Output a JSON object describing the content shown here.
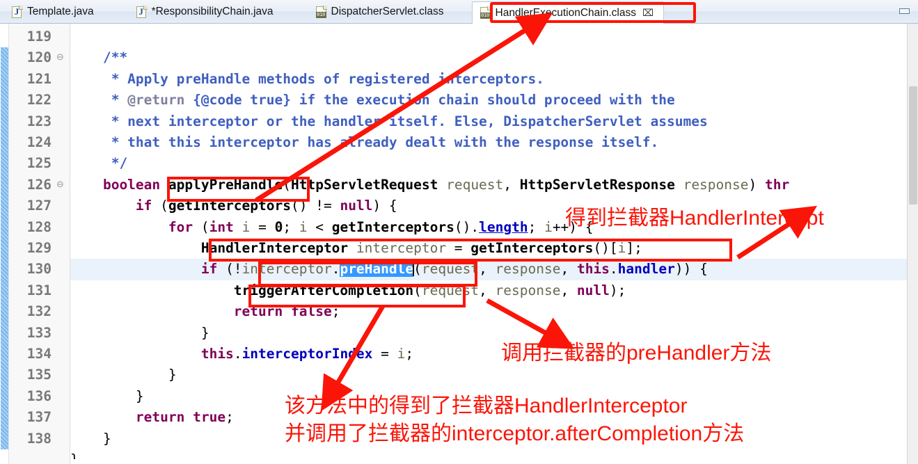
{
  "window": {
    "minimize_label": "Minimize",
    "accent_red": "#fb1508",
    "selection_blue": "#3399ff",
    "current_line_blue": "#eaf2fb"
  },
  "tabs": [
    {
      "label": "Template.java",
      "icon": "java-file-icon",
      "active": false,
      "dirty": false
    },
    {
      "label": "*ResponsibilityChain.java",
      "icon": "java-file-icon",
      "active": false,
      "dirty": true
    },
    {
      "label": "DispatcherServlet.class",
      "icon": "class-file-icon",
      "active": false,
      "dirty": false
    },
    {
      "label": "HandlerExecutionChain.class",
      "icon": "class-file-icon",
      "active": true,
      "dirty": false,
      "close_glyph": "⌧"
    }
  ],
  "editor": {
    "first_line": 119,
    "line_numbers": [
      "119",
      "120",
      "121",
      "122",
      "123",
      "124",
      "125",
      "126",
      "127",
      "128",
      "129",
      "130",
      "131",
      "132",
      "133",
      "134",
      "135",
      "136",
      "137",
      "138"
    ],
    "fold_lines": [
      "120",
      "126"
    ],
    "fold_glyph": "⊖",
    "current_line": 130,
    "selected_token": "preHandle",
    "code_lines": [
      "",
      "    /**",
      "     * Apply preHandle methods of registered interceptors.",
      "     * @return {@code true} if the execution chain should proceed with the",
      "     * next interceptor or the handler itself. Else, DispatcherServlet assumes",
      "     * that this interceptor has already dealt with the response itself.",
      "     */",
      "    boolean applyPreHandle(HttpServletRequest request, HttpServletResponse response) thr",
      "        if (getInterceptors() != null) {",
      "            for (int i = 0; i < getInterceptors().length; i++) {",
      "                HandlerInterceptor interceptor = getInterceptors()[i];",
      "                if (!interceptor.preHandle(request, response, this.handler)) {",
      "                    triggerAfterCompletion(request, response, null);",
      "                    return false;",
      "                }",
      "                this.interceptorIndex = i;",
      "            }",
      "        }",
      "        return true;",
      "    }"
    ]
  },
  "annotations": {
    "boxes": [
      {
        "name": "active-tab-highlight-box"
      },
      {
        "name": "apply-pre-handle-box"
      },
      {
        "name": "handler-interceptor-line-box"
      },
      {
        "name": "pre-handle-call-box"
      },
      {
        "name": "trigger-after-completion-box"
      }
    ],
    "notes": [
      {
        "name": "note-get-interceptor",
        "text": "得到拦截器HandlerIntercept"
      },
      {
        "name": "note-call-prehandler",
        "text": "调用拦截器的preHandler方法"
      },
      {
        "name": "note-summary-line1",
        "text": "该方法中的得到了拦截器HandlerInterceptor"
      },
      {
        "name": "note-summary-line2",
        "text": "并调用了拦截器的interceptor.afterCompletion方法"
      }
    ]
  }
}
